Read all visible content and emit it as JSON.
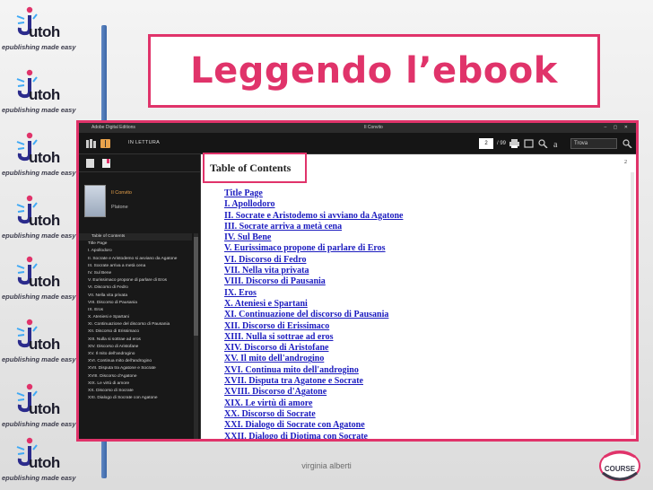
{
  "slide": {
    "title": "Leggendo l’ebook",
    "footer": "virginia alberti",
    "accent_color": "#e0336a",
    "bar_color": "#3d67a8"
  },
  "logo": {
    "word": "utoh",
    "tagline": "epublishing made easy"
  },
  "course_badge": {
    "text": "COURSE"
  },
  "app": {
    "window_title": "Adobe Digital Editions",
    "book_window_title": "Il Convito",
    "view_label": "IN LETTURA",
    "page_current": "2",
    "page_total": "/ 99",
    "search_placeholder": "Trova",
    "page_number": "2"
  },
  "sidebar": {
    "book_title": "Il Convito",
    "book_author": "Platone",
    "items": [
      "Table of Contents",
      "Title Page",
      "I. Apollodoro",
      "II. Socrate e Aristodemo si avviano da Agatone",
      "III. Socrate arriva a metà cena",
      "IV. Sul Bene",
      "V. Eurissimaco propone di parlare di Eros",
      "VI. Discorso di Fedro",
      "VII. Nella vita privata",
      "VIII. Discorso di Pausania",
      "IX. Eros",
      "X. Ateniesi e Spartani",
      "XI. Continuazione del discorso di Pausania",
      "XII. Discorso di Erissimaco",
      "XIII. Nulla si sottrae ad eros",
      "XIV. Discorso di Aristofane",
      "XV. Il mito dell'androgino",
      "XVI. Continua mito dell'androgino",
      "XVII. Disputa tra Agatone e Socrate",
      "XVIII. Discorso d'Agatone",
      "XIX. Le virtù di amore",
      "XX. Discorso di Socrate",
      "XXI. Dialogo di Socrate con Agatone"
    ]
  },
  "content": {
    "heading": "Table of Contents",
    "chapters": [
      "Title Page",
      "I. Apollodoro",
      "II. Socrate e Aristodemo si avviano da Agatone",
      "III. Socrate arriva a metà cena",
      "IV. Sul Bene",
      "V. Eurissimaco propone di parlare di Eros",
      "VI. Discorso di Fedro",
      "VII. Nella vita privata",
      "VIII. Discorso di Pausania",
      "IX. Eros",
      "X. Ateniesi e Spartani",
      "XI. Continuazione del discorso di Pausania",
      "XII. Discorso di Erissimaco",
      "XIII. Nulla si sottrae ad eros",
      "XIV. Discorso di Aristofane",
      "XV. Il mito dell'androgino",
      "XVI. Continua mito dell'androgino",
      "XVII. Disputa tra Agatone e Socrate",
      "XVIII. Discorso d'Agatone",
      "XIX. Le virtù di amore",
      "XX. Discorso di Socrate",
      "XXI. Dialogo di Socrate con Agatone",
      "XXII. Dialogo di Diotima con Socrate"
    ]
  }
}
